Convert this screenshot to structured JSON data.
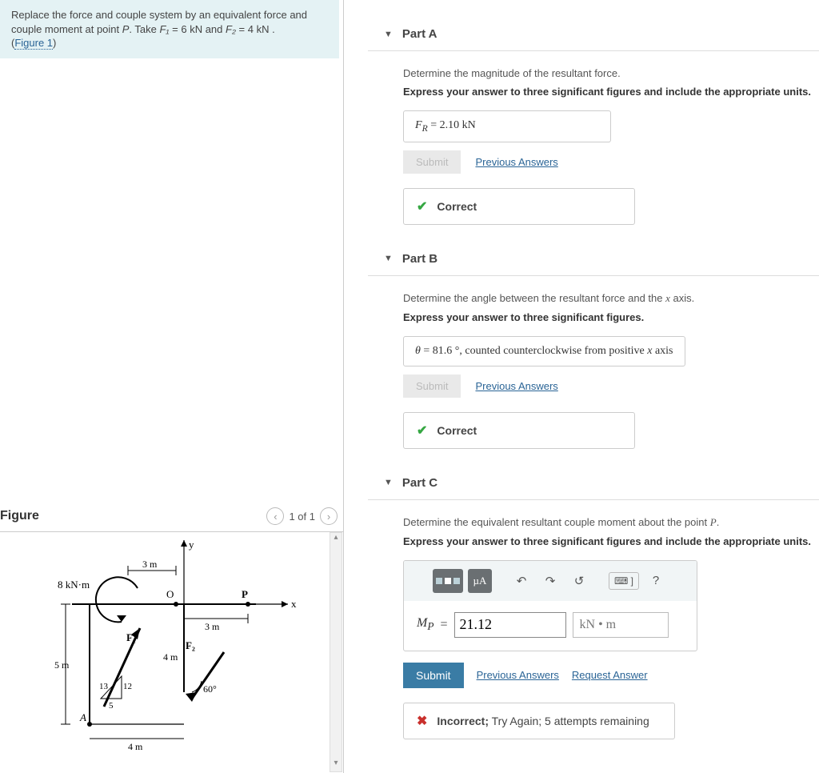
{
  "problem": {
    "text_pre": "Replace the force and couple system by an equivalent force and couple moment at point ",
    "point": "P",
    "take": ". Take ",
    "f1_sym": "F₁",
    "f1_eq": " = 6 kN",
    "and": " and ",
    "f2_sym": "F₂",
    "f2_eq": " = 4 kN",
    "period": " .",
    "figlink": "Figure 1"
  },
  "figure": {
    "title": "Figure",
    "pager": "1 of 1",
    "labels": {
      "y": "y",
      "x": "x",
      "O": "O",
      "P": "P",
      "A": "A",
      "moment": "8 kN·m",
      "F1": "F₁",
      "F2": "F₂",
      "d3a": "3 m",
      "d3b": "3 m",
      "d4v": "4 m",
      "d4h": "4 m",
      "d5": "5 m",
      "t13": "13",
      "t12": "12",
      "t5": "5",
      "ang60": "60°"
    }
  },
  "parts": {
    "A": {
      "title": "Part A",
      "instr": "Determine the magnitude of the resultant force.",
      "bold": "Express your answer to three significant figures and include the appropriate units.",
      "answer_sym": "F_R",
      "answer_val": " =  2.10 kN",
      "submit": "Submit",
      "prev": "Previous Answers",
      "status": "Correct"
    },
    "B": {
      "title": "Part B",
      "instr_pre": "Determine the angle between the resultant force and the ",
      "instr_x": "x",
      "instr_post": " axis.",
      "bold": "Express your answer to three significant figures.",
      "answer_sym": "θ",
      "answer_val": " =  81.6  °",
      "answer_note": ", counted counterclockwise from positive ",
      "answer_axis": "x",
      "answer_note2": " axis",
      "submit": "Submit",
      "prev": "Previous Answers",
      "status": "Correct"
    },
    "C": {
      "title": "Part C",
      "instr_pre": "Determine the equivalent resultant couple moment about the point ",
      "instr_p": "P",
      "instr_post": ".",
      "bold": "Express your answer to three significant figures and include the appropriate units.",
      "toolbar": {
        "mu": "µA",
        "undo": "↶",
        "redo": "↷",
        "reset": "↺",
        "kb": "⌨ ]",
        "help": "?"
      },
      "answer_sym": "M_P",
      "answer_eq": " = ",
      "value": "21.12",
      "units": "kN • m",
      "submit": "Submit",
      "prev": "Previous Answers",
      "req": "Request Answer",
      "status_bold": "Incorrect;",
      "status_rest": " Try Again; 5 attempts remaining"
    }
  }
}
